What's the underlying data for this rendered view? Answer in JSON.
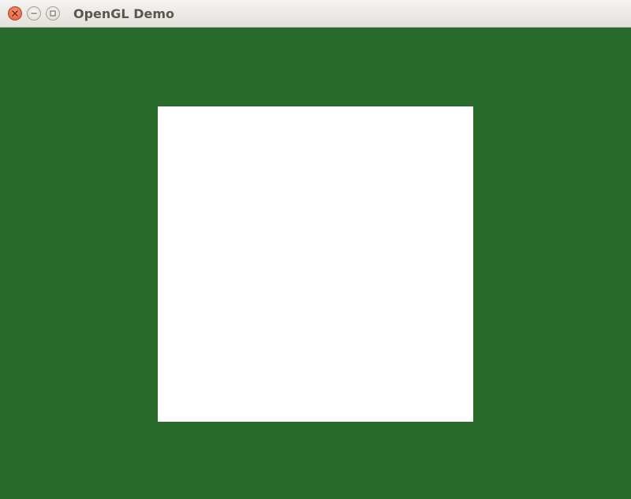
{
  "window": {
    "title": "OpenGL Demo",
    "controls": [
      {
        "name": "close",
        "icon": "close-icon"
      },
      {
        "name": "minimize",
        "icon": "minimize-icon"
      },
      {
        "name": "maximize",
        "icon": "maximize-icon"
      }
    ]
  },
  "scene": {
    "clear_color": "#286a2a",
    "quad_color": "#ffffff"
  }
}
